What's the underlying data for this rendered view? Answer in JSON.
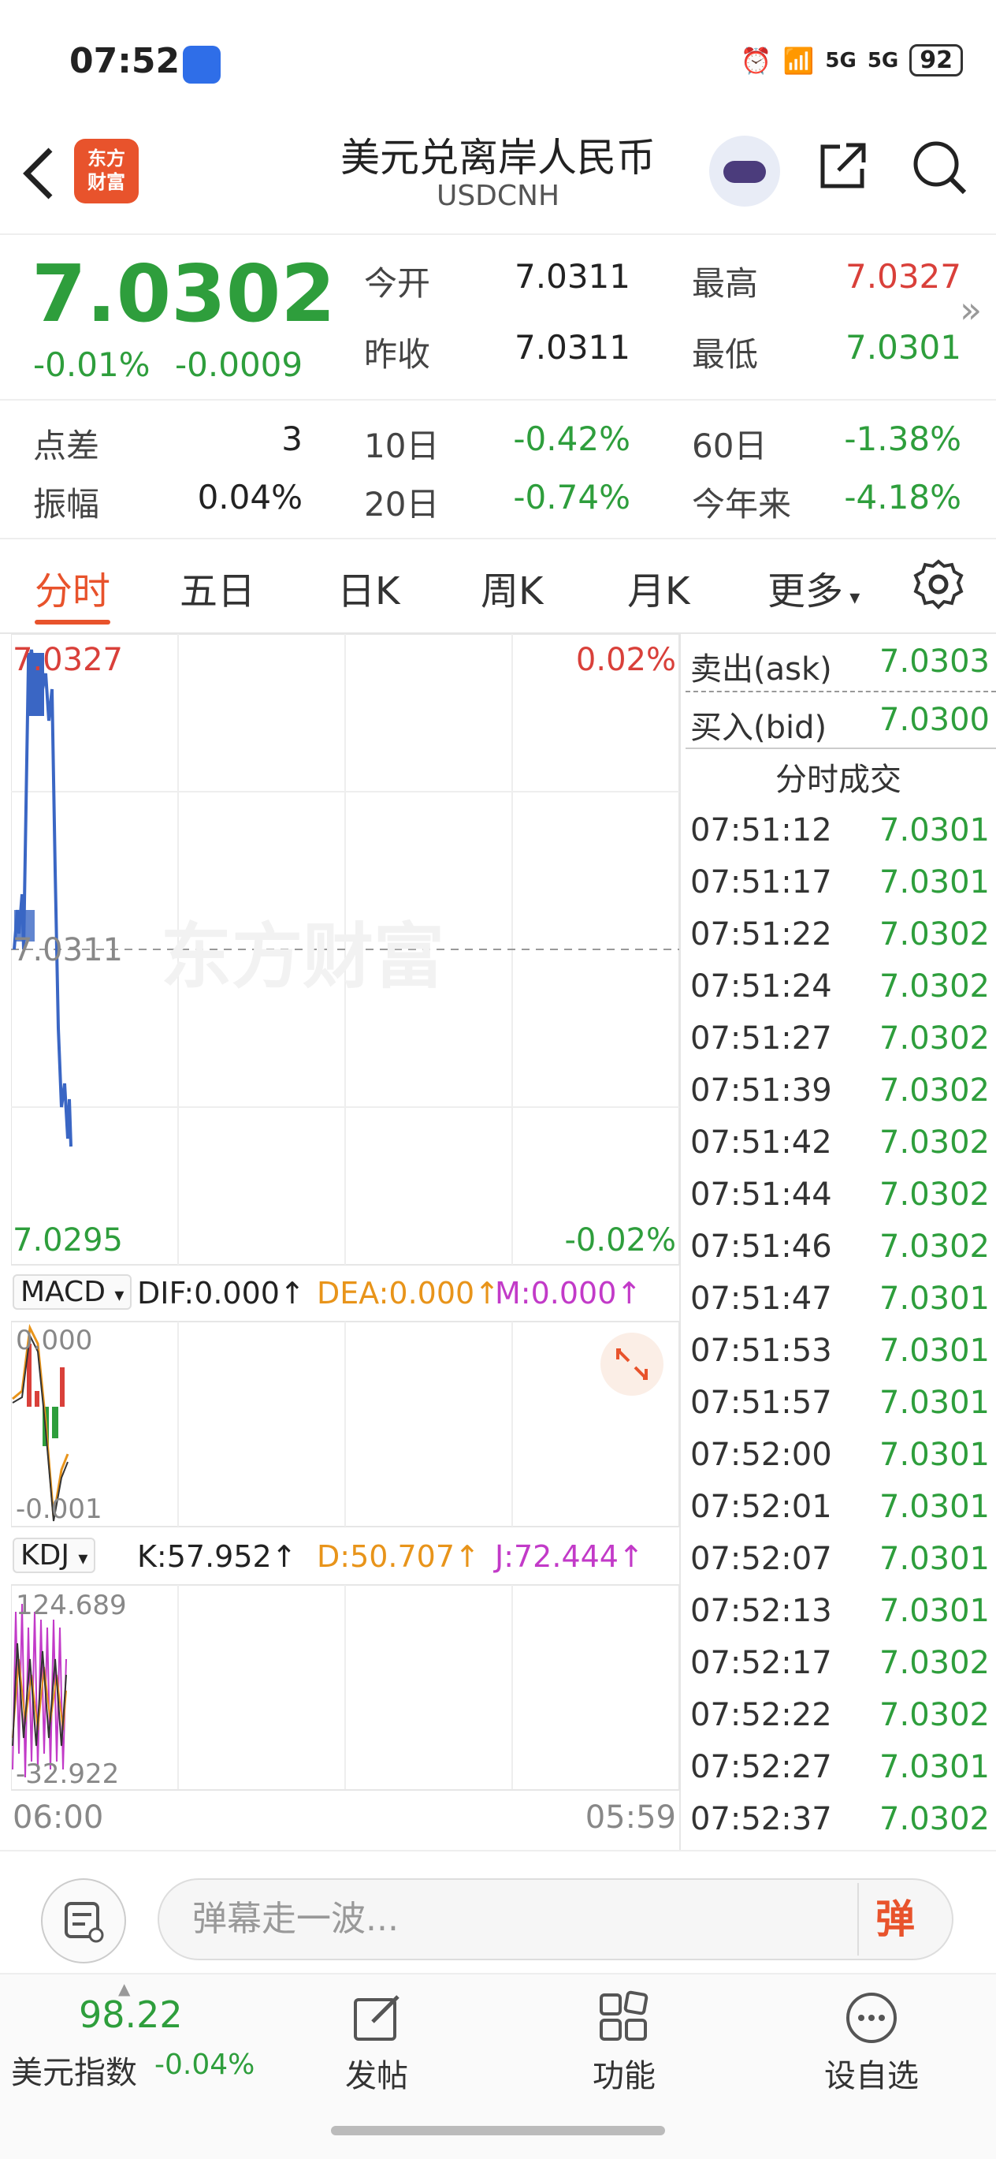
{
  "status_bar": {
    "time": "07:52",
    "network1": "5G",
    "network2": "5G",
    "battery": "92"
  },
  "header": {
    "title": "美元兑离岸人民币",
    "subtitle": "USDCNH",
    "logo_text": "东方\n财富",
    "back_icon": "chevron-left-icon",
    "share_icon": "share-icon",
    "search_icon": "search-icon"
  },
  "quote": {
    "price": "7.0302",
    "pct": "-0.01%",
    "change": "-0.0009",
    "open_label": "今开",
    "open": "7.0311",
    "high_label": "最高",
    "high": "7.0327",
    "prev_label": "昨收",
    "prev": "7.0311",
    "low_label": "最低",
    "low": "7.0301",
    "spread_label": "点差",
    "spread": "3",
    "d10_label": "10日",
    "d10": "-0.42%",
    "d60_label": "60日",
    "d60": "-1.38%",
    "amp_label": "振幅",
    "amp": "0.04%",
    "d20_label": "20日",
    "d20": "-0.74%",
    "ytd_label": "今年来",
    "ytd": "-4.18%",
    "more": "»"
  },
  "tabs": [
    "分时",
    "五日",
    "日K",
    "周K",
    "月K",
    "更多"
  ],
  "chart": {
    "top_price": "7.0327",
    "top_pct": "0.02%",
    "mid_price": "7.0311",
    "watermark": "东方财富",
    "bottom_price": "7.0295",
    "bottom_pct": "-0.02%",
    "start_time": "06:00",
    "end_time": "05:59"
  },
  "macd": {
    "name": "MACD",
    "dif": "DIF:0.000↑",
    "dea": "DEA:0.000↑",
    "m": "M:0.000↑",
    "top": "0.000",
    "bottom": "-0.001"
  },
  "kdj": {
    "name": "KDJ",
    "k": "K:57.952↑",
    "d": "D:50.707↑",
    "j": "J:72.444↑",
    "top": "124.689",
    "bottom": "-32.922"
  },
  "side": {
    "ask_label": "卖出(ask)",
    "ask": "7.0303",
    "bid_label": "买入(bid)",
    "bid": "7.0300",
    "trades_title": "分时成交",
    "trades": [
      {
        "t": "07:51:12",
        "p": "7.0301"
      },
      {
        "t": "07:51:17",
        "p": "7.0301"
      },
      {
        "t": "07:51:22",
        "p": "7.0302"
      },
      {
        "t": "07:51:24",
        "p": "7.0302"
      },
      {
        "t": "07:51:27",
        "p": "7.0302"
      },
      {
        "t": "07:51:39",
        "p": "7.0302"
      },
      {
        "t": "07:51:42",
        "p": "7.0302"
      },
      {
        "t": "07:51:44",
        "p": "7.0302"
      },
      {
        "t": "07:51:46",
        "p": "7.0302"
      },
      {
        "t": "07:51:47",
        "p": "7.0301"
      },
      {
        "t": "07:51:53",
        "p": "7.0301"
      },
      {
        "t": "07:51:57",
        "p": "7.0301"
      },
      {
        "t": "07:52:00",
        "p": "7.0301"
      },
      {
        "t": "07:52:01",
        "p": "7.0301"
      },
      {
        "t": "07:52:07",
        "p": "7.0301"
      },
      {
        "t": "07:52:13",
        "p": "7.0301"
      },
      {
        "t": "07:52:17",
        "p": "7.0302"
      },
      {
        "t": "07:52:22",
        "p": "7.0302"
      },
      {
        "t": "07:52:27",
        "p": "7.0301"
      },
      {
        "t": "07:52:37",
        "p": "7.0302"
      }
    ]
  },
  "input_bar": {
    "placeholder": "弹幕走一波...",
    "send_label": "弹"
  },
  "bottom_nav": {
    "index_value": "98.22",
    "index_name": "美元指数",
    "index_pct": "-0.04%",
    "post_label": "发帖",
    "func_label": "功能",
    "watchlist_label": "设自选"
  },
  "colors": {
    "accent": "#e8532c",
    "up": "#d9403a",
    "down": "#2e9e3c",
    "line": "#3a66c4"
  }
}
